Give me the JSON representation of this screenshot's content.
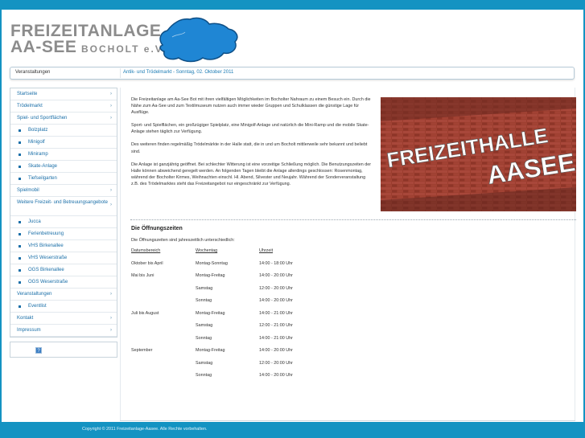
{
  "logo": {
    "line1": "FREIZEITANLAGE",
    "line2": "AA-SEE",
    "sub": "BOCHOLT e.V.",
    "lake_color": "#1f86d4"
  },
  "breadcrumb": {
    "section": "Veranstaltungen",
    "current": "Antik- und Trödelmarkt - Sonntag, 02. Oktober 2011"
  },
  "nav": {
    "items": [
      {
        "label": "Startseite",
        "type": "top"
      },
      {
        "label": "Trödelmarkt",
        "type": "top"
      },
      {
        "label": "Spiel- und Sportflächen",
        "type": "top"
      },
      {
        "label": "Bolzplatz",
        "type": "sub"
      },
      {
        "label": "Minigolf",
        "type": "sub"
      },
      {
        "label": "Miniramp",
        "type": "sub"
      },
      {
        "label": "Skate-Anlage",
        "type": "sub"
      },
      {
        "label": "Tiefseilgarten",
        "type": "sub"
      },
      {
        "label": "Spielmobil",
        "type": "top"
      },
      {
        "label": "Weitere Freizeit- und Betreuungsangebote",
        "type": "top-two"
      },
      {
        "label": "Jucca",
        "type": "sub"
      },
      {
        "label": "Ferienbetreuung",
        "type": "sub"
      },
      {
        "label": "VHS Birkenallee",
        "type": "sub"
      },
      {
        "label": "VHS Weserstraße",
        "type": "sub"
      },
      {
        "label": "OGS Birkenallee",
        "type": "sub"
      },
      {
        "label": "OGS Weserstraße",
        "type": "sub"
      },
      {
        "label": "Veranstaltungen",
        "type": "top"
      },
      {
        "label": "Eventlist",
        "type": "sub"
      },
      {
        "label": "Kontakt",
        "type": "top"
      },
      {
        "label": "Impressum",
        "type": "top"
      }
    ],
    "chevron": "›"
  },
  "side_icon": "?",
  "intro": {
    "p1": "Die Freizeitanlage am Aa-See Bot mit ihren vielfältigen Möglichkeiten im Bocholter Nahraum zu einem Besuch ein. Durch die Nähe zum Aa-See und zum Textilmuseum nutzen auch immer wieder Gruppen und Schulklassen die günstige Lage für Ausflüge.",
    "p2": "Sport- und Spielflächen, ein großzügiger Spielplatz, eine Minigolf-Anlage und natürlich die Mini-Ramp und die mobile Skate-Anlage stehen täglich zur Verfügung.",
    "p3": "Des weiteren finden regelmäßig Trödelmärkte in der Halle statt, die in und um Bocholt mittlerweile sehr bekannt und beliebt sind.",
    "p4": "Die Anlage ist ganzjährig geöffnet. Bei schlechter Witterung ist eine vorzeitige Schließung möglich. Die Benutzungszeiten der Halle können abweichend geregelt werden. An folgenden Tagen bleibt die Anlage allerdings geschlossen: Rosenmontag, während der Bocholter Kirmes, Weihnachten einschl. Hl. Abend, Silvester und Neujahr. Während der Sonderveranstaltung z.B. des Trödelmarktes steht das Freizeitangebot nur eingeschränkt zur Verfügung."
  },
  "photo_sign": {
    "line1": "FREIZEITHALLE",
    "line2": "AASEE"
  },
  "hours": {
    "title": "Die Öffnungszeiten",
    "subtitle": "Die Öffnungszeiten sind jahreszeitlich unterschiedlich:",
    "headers": [
      "Datumsbereich",
      "Wochentag",
      "Uhrzeit"
    ],
    "rows": [
      [
        "Oktober bis April",
        "Montag-Sonntag",
        "14:00 - 18:00 Uhr"
      ],
      [
        "Mai bis Juni",
        "Montag-Freitag",
        "14:00 - 20:00 Uhr"
      ],
      [
        "",
        "Samstag",
        "12:00 - 20:00 Uhr"
      ],
      [
        "",
        "Sonntag",
        "14:00 - 20:00 Uhr"
      ],
      [
        "Juli bis August",
        "Montag-Freitag",
        "14:00 - 21:00 Uhr"
      ],
      [
        "",
        "Samstag",
        "12:00 - 21:00 Uhr"
      ],
      [
        "",
        "Sonntag",
        "14:00 - 21:00 Uhr"
      ],
      [
        "September",
        "Montag-Freitag",
        "14:00 - 20:00 Uhr"
      ],
      [
        "",
        "Samstag",
        "12:00 - 20:00 Uhr"
      ],
      [
        "",
        "Sonntag",
        "14:00 - 20:00 Uhr"
      ]
    ]
  },
  "footer": {
    "copyright": "Copyright © 2011 Freizeitanlage-Aasee. Alle Rechte vorbehalten."
  }
}
